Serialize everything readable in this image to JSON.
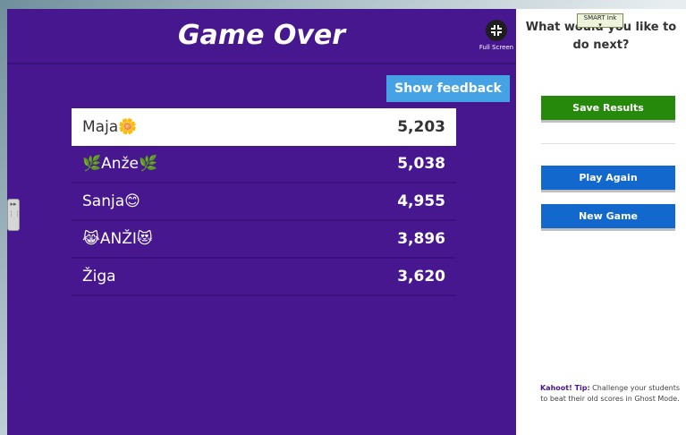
{
  "game": {
    "title": "Game Over",
    "fullscreen_label": "Full Screen",
    "feedback_button": "Show feedback",
    "scores": [
      {
        "name": "Maja🌼",
        "points": "5,203"
      },
      {
        "name": "🌿Anže🌿",
        "points": "5,038"
      },
      {
        "name": "Sanja😊",
        "points": "4,955"
      },
      {
        "name": "😹ANŽI😻",
        "points": "3,896"
      },
      {
        "name": "Žiga",
        "points": "3,620"
      }
    ]
  },
  "side": {
    "question": "What would you like to do next?",
    "save_button": "Save Results",
    "play_again_button": "Play Again",
    "new_game_button": "New Game",
    "tip_label": "Kahoot! Tip:",
    "tip_text": " Challenge your students to beat their old scores in Ghost Mode."
  },
  "smart_ink": {
    "label": "SMART Ink"
  },
  "colors": {
    "kahoot_purple": "#46178f",
    "feedback_blue": "#45a3e5",
    "save_green": "#26890c",
    "action_blue": "#1368ce"
  }
}
